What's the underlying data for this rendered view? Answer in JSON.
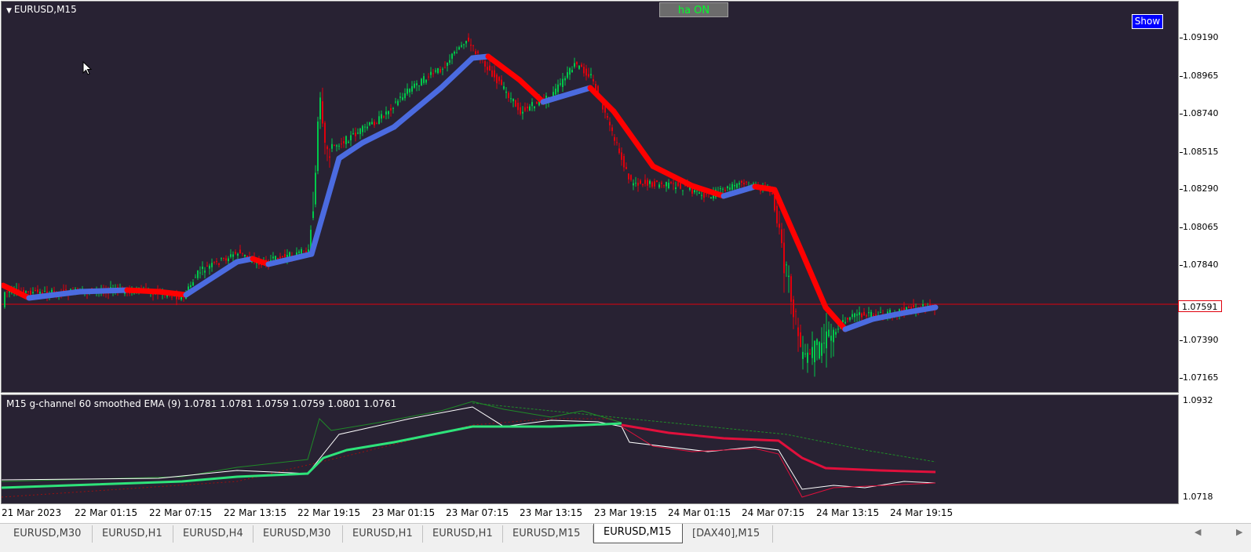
{
  "chart": {
    "symbol_title": "EURUSD,M15",
    "ha_button_label": "ha ON",
    "show_button_label": "Show",
    "current_price": "1.07591",
    "price_labels": [
      "1.09190",
      "1.08965",
      "1.08740",
      "1.08515",
      "1.08290",
      "1.08065",
      "1.07840",
      "1.07390",
      "1.07165"
    ],
    "colors": {
      "background": "#282233",
      "bull": "#00c84a",
      "bear": "#e0000c",
      "trend_up": "#4b6be0",
      "trend_down": "#ff0000",
      "price_line": "#e0000c"
    }
  },
  "indicator": {
    "label": "M15 g-channel  60 smoothed EMA (9) 1.0781 1.0781 1.0759 1.0759 1.0801 1.0761",
    "scale_labels": [
      "1.0932",
      "1.0718"
    ],
    "colors": {
      "mid_up": "#2ee37a",
      "mid_down": "#e0103c",
      "upper": "#1f8a28",
      "lower": "#9a1010",
      "price": "#ffffff"
    }
  },
  "time_labels": [
    "21 Mar 2023",
    "22 Mar 01:15",
    "22 Mar 07:15",
    "22 Mar 13:15",
    "22 Mar 19:15",
    "23 Mar 01:15",
    "23 Mar 07:15",
    "23 Mar 13:15",
    "23 Mar 19:15",
    "24 Mar 01:15",
    "24 Mar 07:15",
    "24 Mar 13:15",
    "24 Mar 19:15"
  ],
  "tabs": [
    {
      "label": "EURUSD,M30",
      "active": false
    },
    {
      "label": "EURUSD,H1",
      "active": false
    },
    {
      "label": "EURUSD,H4",
      "active": false
    },
    {
      "label": "EURUSD,M30",
      "active": false
    },
    {
      "label": "EURUSD,H1",
      "active": false
    },
    {
      "label": "EURUSD,H1",
      "active": false
    },
    {
      "label": "EURUSD,M15",
      "active": false
    },
    {
      "label": "EURUSD,M15",
      "active": true
    },
    {
      "label": "[DAX40],M15",
      "active": false
    }
  ],
  "nav": {
    "prev_icon": "arrow-left-icon",
    "next_icon": "arrow-right-icon"
  }
}
